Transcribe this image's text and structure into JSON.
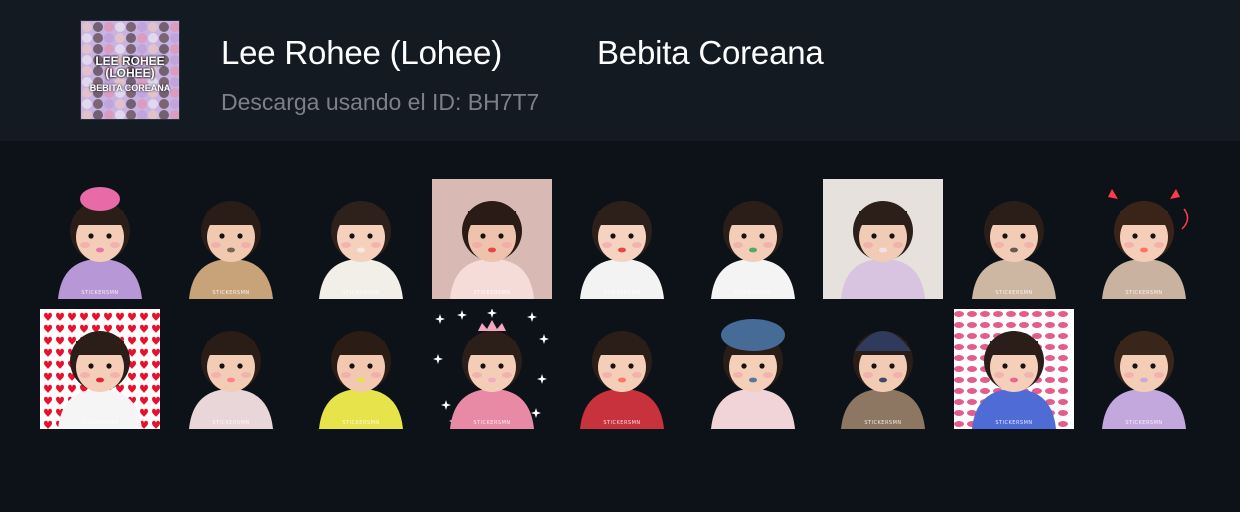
{
  "header": {
    "title_part1": "Lee Rohee (Lohee)",
    "title_part2": "Bebita Coreana",
    "download_hint": "Descarga usando el ID: BH7T7",
    "thumbnail": {
      "line1": "LEE ROHEE",
      "line2": "(LOHEE)",
      "line3": "BEBITA COREANA"
    }
  },
  "stickers": [
    {
      "name": "sticker-1",
      "bg": "none",
      "skin": "#f4cdb8",
      "hair": "#2b1d18",
      "top": "#b897d6",
      "accent": "#e86aa6",
      "hat": "pink-hat",
      "watermark": "STICKERSMN"
    },
    {
      "name": "sticker-2",
      "bg": "none",
      "skin": "#f1c9b1",
      "hair": "#2a1c17",
      "top": "#c8a37a",
      "accent": "#6a5a4a",
      "hat": "none",
      "watermark": "STICKERSMN"
    },
    {
      "name": "sticker-3",
      "bg": "none",
      "skin": "#f5d1bd",
      "hair": "#2e201a",
      "top": "#f2eee8",
      "accent": "#f2eee8",
      "hat": "none",
      "watermark": "STICKERSMN"
    },
    {
      "name": "sticker-4",
      "bg": "#d9b9b3",
      "skin": "#efc2ad",
      "hair": "#2a1b16",
      "top": "#f5dcd8",
      "accent": "#e23a3a",
      "hat": "none",
      "watermark": "STICKERSMN"
    },
    {
      "name": "sticker-5",
      "bg": "none",
      "skin": "#f6d3c0",
      "hair": "#2d1f19",
      "top": "#f3f3f3",
      "accent": "#e23a3a",
      "hat": "none",
      "watermark": "STICKERSMN"
    },
    {
      "name": "sticker-6",
      "bg": "none",
      "skin": "#f3cdb8",
      "hair": "#2b1e18",
      "top": "#f4f4f4",
      "accent": "#47a35a",
      "hat": "none",
      "watermark": "STICKERSMN"
    },
    {
      "name": "sticker-7",
      "bg": "#e6e1dd",
      "skin": "#f0cbb6",
      "hair": "#2c1e18",
      "top": "#d8c3e0",
      "accent": "#efe6ea",
      "hat": "none",
      "watermark": ""
    },
    {
      "name": "sticker-8",
      "bg": "none",
      "skin": "#f2ccb7",
      "hair": "#2b1d17",
      "top": "#cdb6a2",
      "accent": "#5b4b43",
      "hat": "none",
      "watermark": "STICKERSMN"
    },
    {
      "name": "sticker-9",
      "bg": "none",
      "skin": "#f4ceb8",
      "hair": "#3a241a",
      "top": "#c9b2a0",
      "accent": "#ff6a5a",
      "hat": "devil-horns",
      "watermark": "STICKERSMN"
    },
    {
      "name": "sticker-10",
      "bg": "hearts",
      "skin": "#f4ceb9",
      "hair": "#2b1d17",
      "top": "#f5f5f5",
      "accent": "#e8112d",
      "hat": "none",
      "watermark": "STICKERSMN"
    },
    {
      "name": "sticker-11",
      "bg": "none",
      "skin": "#f3ccb6",
      "hair": "#2a1c16",
      "top": "#e9d6d8",
      "accent": "#ff7b8a",
      "hat": "none",
      "watermark": "STICKERSMN"
    },
    {
      "name": "sticker-12",
      "bg": "none",
      "skin": "#f2c8b1",
      "hair": "#2b1c16",
      "top": "#e7e34a",
      "accent": "#e7e34a",
      "hat": "none",
      "watermark": "STICKERSMN"
    },
    {
      "name": "sticker-13",
      "bg": "sparkles",
      "skin": "#f4cdb8",
      "hair": "#2c1e18",
      "top": "#e88aa5",
      "accent": "#f2a7c0",
      "hat": "tiara",
      "watermark": "STICKERSMN"
    },
    {
      "name": "sticker-14",
      "bg": "none",
      "skin": "#f4ceb9",
      "hair": "#2b1d17",
      "top": "#c7323c",
      "accent": "#ff6a5a",
      "hat": "none",
      "watermark": "STICKERSMN"
    },
    {
      "name": "sticker-15",
      "bg": "none",
      "skin": "#f4cfba",
      "hair": "#2a1c16",
      "top": "#f1d4d8",
      "accent": "#466b96",
      "hat": "beret",
      "watermark": ""
    },
    {
      "name": "sticker-16",
      "bg": "none",
      "skin": "#f2cbb5",
      "hair": "#2a1c16",
      "top": "#8d7762",
      "accent": "#2f3a5c",
      "hat": "beanie",
      "watermark": "STICKERSMN"
    },
    {
      "name": "sticker-17",
      "bg": "pink-lips",
      "skin": "#f5cfba",
      "hair": "#2b1d17",
      "top": "#4f6bd6",
      "accent": "#e45c8a",
      "hat": "none",
      "watermark": "STICKERSMN"
    },
    {
      "name": "sticker-18",
      "bg": "none",
      "skin": "#f4cdb7",
      "hair": "#3a251b",
      "top": "#c3a8de",
      "accent": "#c3a8de",
      "hat": "none",
      "watermark": "STICKERSMN"
    }
  ]
}
